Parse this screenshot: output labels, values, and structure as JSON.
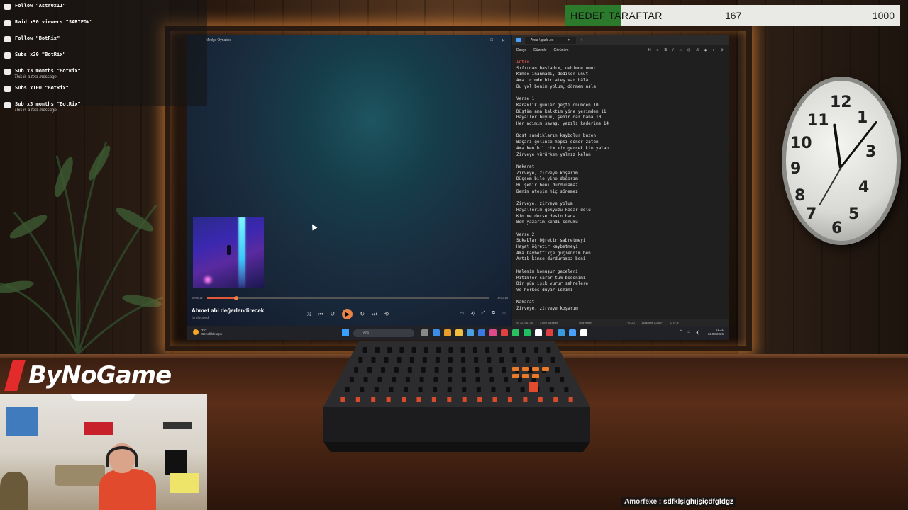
{
  "event_feed": [
    {
      "icon": "follow-icon",
      "text": "Follow \"Astr0x11\"",
      "message": ""
    },
    {
      "icon": "raid-icon",
      "text": "Raid x90 viewers \"SARIFOV\"",
      "message": ""
    },
    {
      "icon": "follow-icon",
      "text": "Follow \"BotRix\"",
      "message": ""
    },
    {
      "icon": "subs-icon",
      "text": "Subs x20 \"BotRix\"",
      "message": ""
    },
    {
      "icon": "star-icon",
      "text": "Sub x3 months \"BotRix\"",
      "message": "This is a test message"
    },
    {
      "icon": "subs-icon",
      "text": "Subs x100 \"BotRix\"",
      "message": ""
    },
    {
      "icon": "star-icon",
      "text": "Sub x3 months \"BotRix\"",
      "message": "This is a test message"
    }
  ],
  "goal": {
    "title": "HEDEF TARAFTAR",
    "current": "167",
    "target": "1000",
    "progress": 0.167,
    "fill_color": "#2c7a2c"
  },
  "media_player": {
    "window_title": "Medya Oynatıcı",
    "track_title": "Ahmet abi değerlendirecek",
    "track_artist": "familybond",
    "time_elapsed": "00:00:14",
    "time_total": "00:02:15",
    "progress": 0.104,
    "accent_color": "#e8834a",
    "controls": [
      "shuffle-icon",
      "previous-icon",
      "rewind-icon",
      "play-icon",
      "forward-icon",
      "next-icon",
      "repeat-icon"
    ],
    "controls_right": [
      "miniplayer-icon",
      "volume-icon",
      "fullscreen-icon",
      "cast-icon",
      "more-icon"
    ]
  },
  "notepad": {
    "tab_title": "Arda \\ şarkı.txt",
    "menu": [
      "Dosya",
      "Düzenle",
      "Görünüm"
    ],
    "lines": [
      "Intro",
      "Sıfırdan başladım, cebimde umut",
      "Kimse inanmadı, dediler unut",
      "Ama içimde bir ateş var hâlâ",
      "Bu yol benim yolum, dönmem asla",
      "",
      "Verse 1",
      "Karanlık günler geçti önümden 10",
      "Düştüm ama kalktım yine yerimden 11",
      "Hayaller büyük, şehir dar bana 10",
      "Her adımım savaş, yazılı kaderime 14",
      "",
      "Dost sandıkların kaybolur bazen",
      "Başarı gelince hepsi döner zaten",
      "Ama ben bilirim kim gerçek kim yalan",
      "Zirveye yürürken yalnız kalan",
      "",
      "Nakarat",
      "Zirveye, zirveye koşarım",
      "Düşsem bile yine doğarım",
      "Bu şehir beni durduramaz",
      "Benim ateşim hiç sönemez",
      "",
      "Zirveye, zirveye yolum",
      "Hayallerim gökyüzü kadar dolu",
      "Kim ne derse desin bana",
      "Ben yazarım kendi sonumu",
      "",
      "Verse 2",
      "Sokaklar öğretir sabretmeyi",
      "Hayat öğretir kaybetmeyi",
      "Ama kaybettikçe güçlendim ben",
      "Artık kimse durduramaz beni",
      "",
      "Kalemim konuşur geceleri",
      "Ritimler sarar tüm bedenimi",
      "Bir gün ışık vurur sahnelere",
      "Ve herkes duyar ismimi",
      "",
      "Nakarat",
      "Zirveye, zirveye koşarım"
    ],
    "status": [
      "St 11, Süt 35",
      "1.089 karakter",
      "Düz metin",
      "%120",
      "Windows (CRLF)",
      "UTF-8"
    ]
  },
  "taskbar": {
    "weather_temp": "3°C",
    "weather_text": "Genellikle açık",
    "search_placeholder": "Ara",
    "time": "01:31",
    "date": "11.03.2026",
    "app_colors": [
      "#888888",
      "#3a8ee6",
      "#e8a02a",
      "#f0c040",
      "#4aa0e0",
      "#3a7ae0",
      "#e04a8a",
      "#e04040",
      "#2ac060",
      "#20c060",
      "#ffffff",
      "#e04040",
      "#3a9ae0",
      "#4aa0ff",
      "#ffffff"
    ]
  },
  "branding": {
    "logo_text": "ByNoGame"
  },
  "chat": {
    "user": "Amorfexe",
    "separator": " : ",
    "message": "sdfklşighıjşiçdfgldgz"
  }
}
